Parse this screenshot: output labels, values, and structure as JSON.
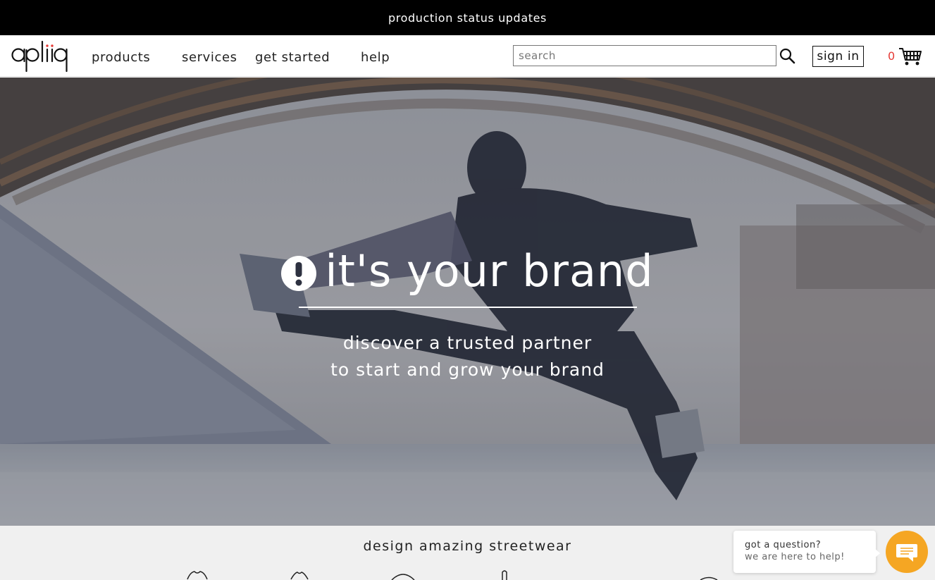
{
  "announcement": {
    "label": "production status updates"
  },
  "header": {
    "logo_text": "apliiq",
    "nav": [
      {
        "label": "products"
      },
      {
        "label": "services"
      },
      {
        "label": "get started"
      },
      {
        "label": "help"
      }
    ],
    "search": {
      "placeholder": "search",
      "value": ""
    },
    "signin_label": "sign in",
    "cart_count": "0"
  },
  "hero": {
    "title": "it's your brand",
    "subtitle_line1": "discover a trusted partner",
    "subtitle_line2": "to start and grow your brand"
  },
  "section": {
    "title": "design amazing streetwear"
  },
  "chat": {
    "question": "got a question?",
    "help": "we are here to help!"
  },
  "colors": {
    "accent": "#f5a623",
    "cart_count": "#e53935",
    "announcement_bg": "#000000"
  }
}
